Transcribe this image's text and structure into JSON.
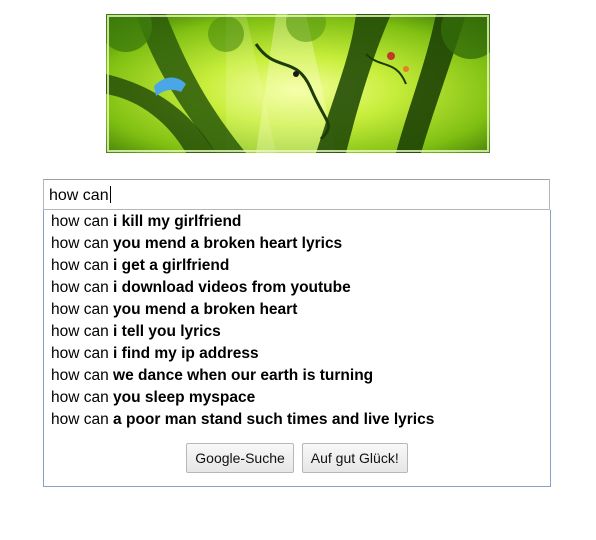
{
  "search": {
    "query": "how can"
  },
  "suggestions": [
    {
      "prefix": "how can",
      "completion": "i kill my girlfriend"
    },
    {
      "prefix": "how can",
      "completion": "you mend a broken heart lyrics"
    },
    {
      "prefix": "how can",
      "completion": "i get a girlfriend"
    },
    {
      "prefix": "how can",
      "completion": "i download videos from youtube"
    },
    {
      "prefix": "how can",
      "completion": "you mend a broken heart"
    },
    {
      "prefix": "how can",
      "completion": "i tell you lyrics"
    },
    {
      "prefix": "how can",
      "completion": "i find my ip address"
    },
    {
      "prefix": "how can",
      "completion": "we dance when our earth is turning"
    },
    {
      "prefix": "how can",
      "completion": "you sleep myspace"
    },
    {
      "prefix": "how can",
      "completion": "a poor man stand such times and live lyrics"
    }
  ],
  "buttons": {
    "search_label": "Google-Suche",
    "lucky_label": "Auf gut Glück!"
  },
  "colors": {
    "dropdown_border": "#8aa0c6",
    "doodle_green": "#9bcf1c"
  }
}
